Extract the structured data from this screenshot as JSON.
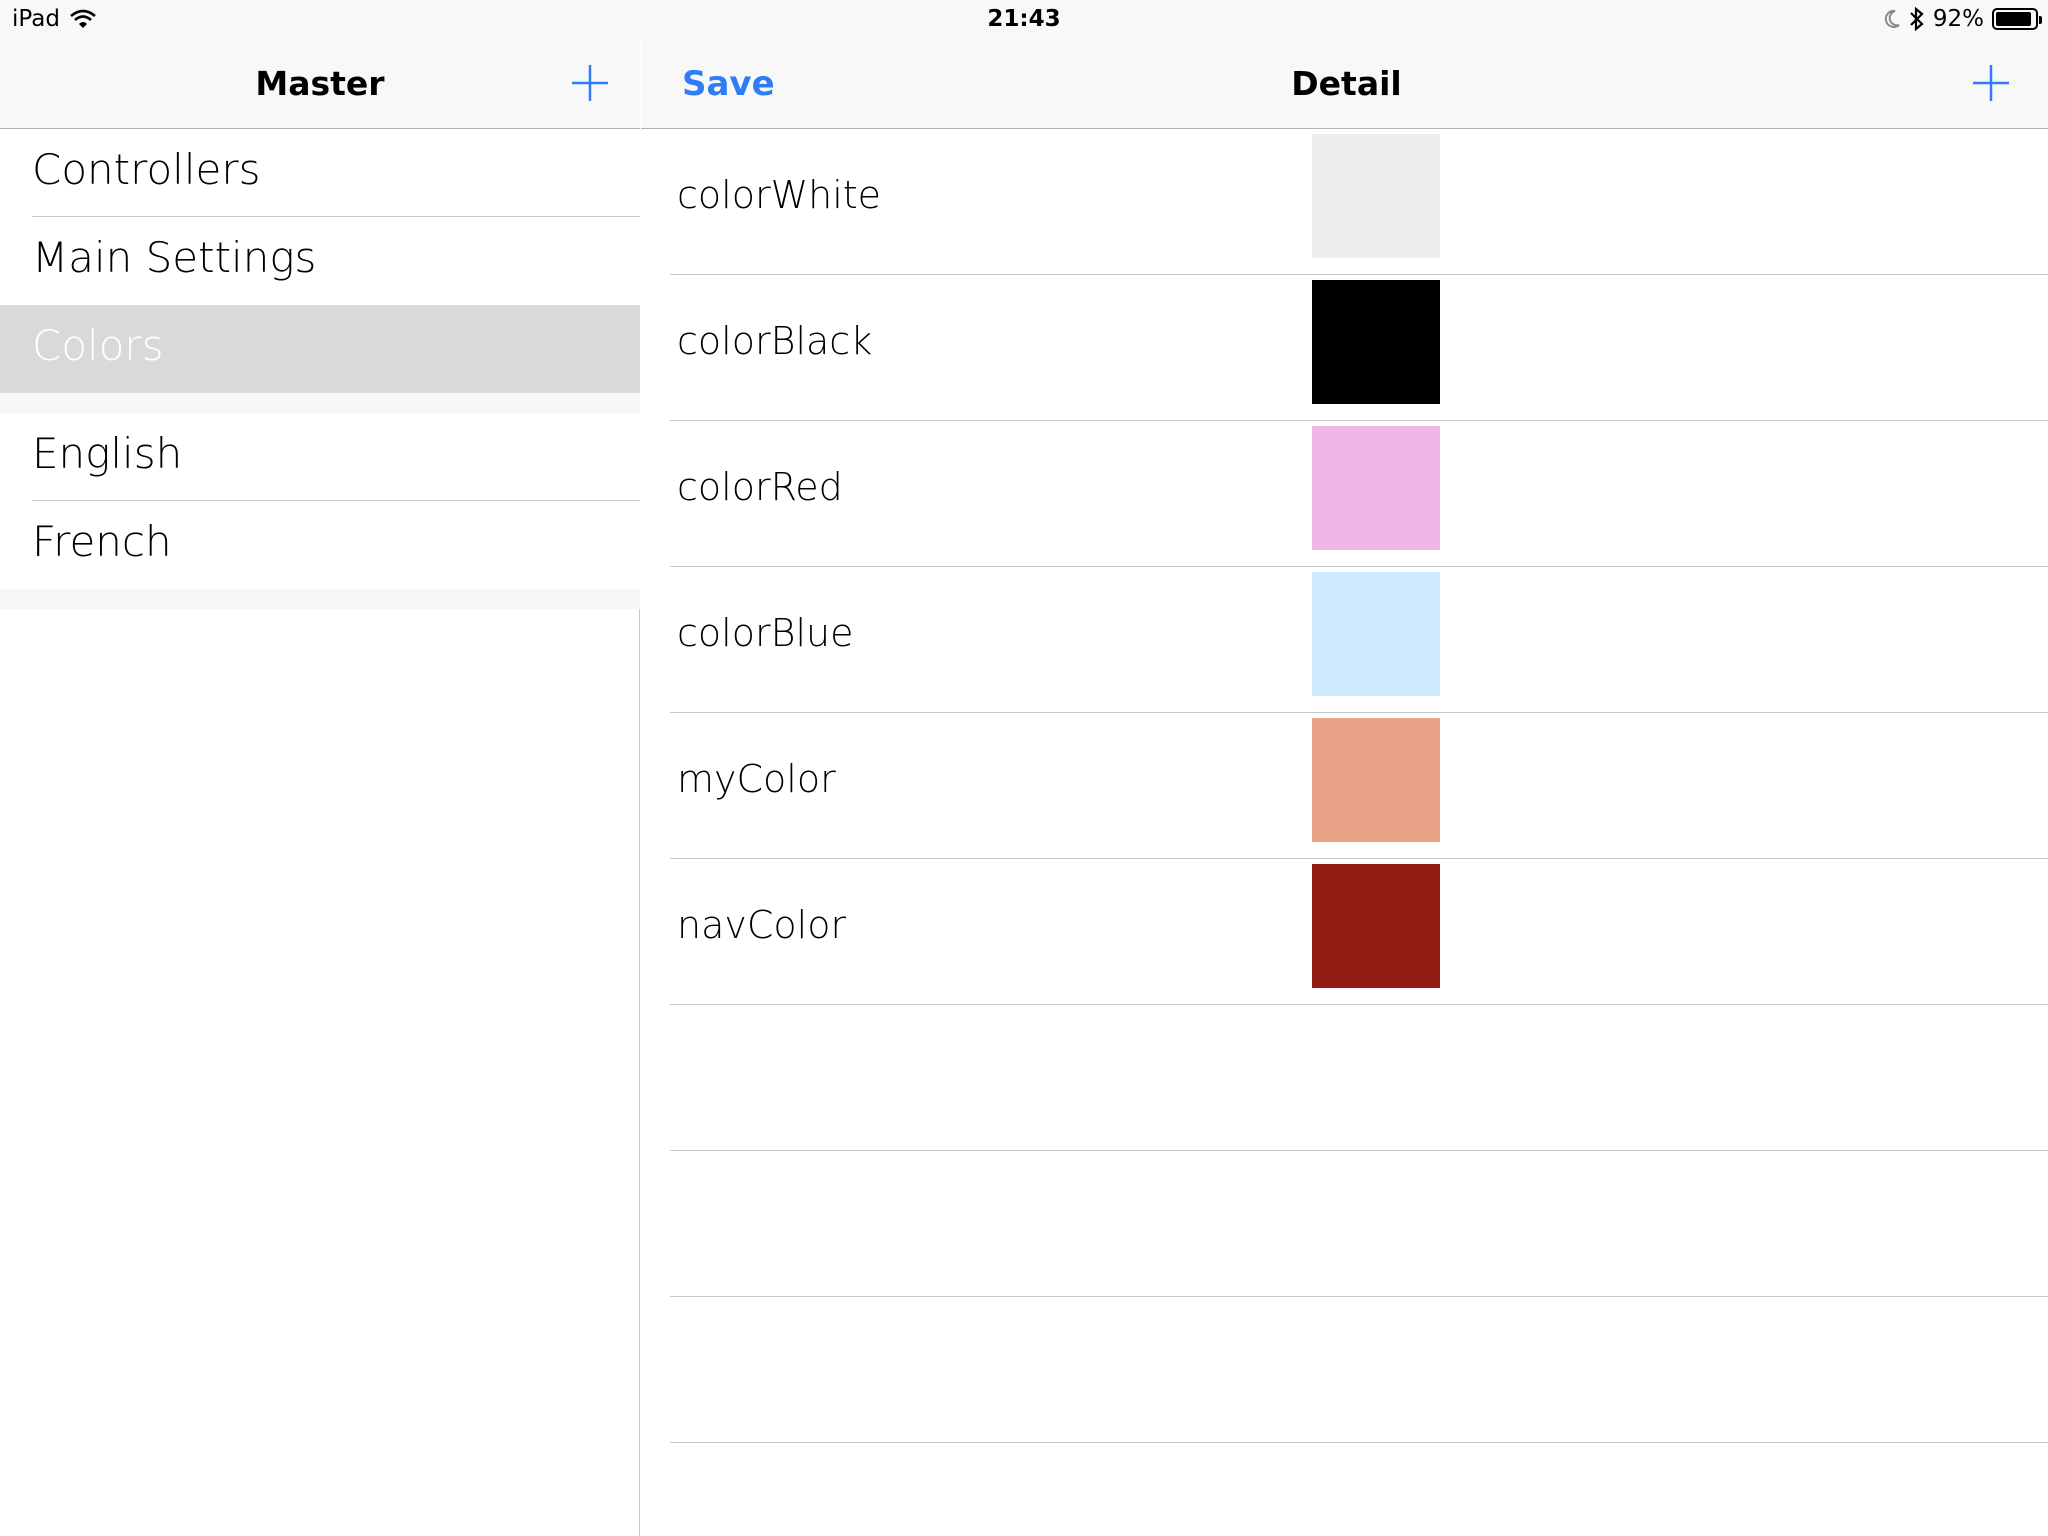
{
  "status_bar": {
    "device": "iPad",
    "time": "21:43",
    "battery": "92%",
    "battery_level": 0.92,
    "icons": [
      "wifi-icon",
      "moon-icon",
      "bluetooth-icon",
      "battery-icon"
    ]
  },
  "master": {
    "title": "Master",
    "add_icon": "plus-icon",
    "sections": [
      {
        "items": [
          {
            "label": "Controllers",
            "selected": false
          },
          {
            "label": "Main Settings",
            "selected": false
          },
          {
            "label": "Colors",
            "selected": true
          }
        ]
      },
      {
        "items": [
          {
            "label": "English",
            "selected": false
          },
          {
            "label": "French",
            "selected": false
          }
        ]
      }
    ]
  },
  "detail": {
    "title": "Detail",
    "save_label": "Save",
    "add_icon": "plus-icon",
    "accent_color": "#2e7cf6",
    "colors": [
      {
        "name": "colorWhite",
        "swatch": "#ebeced"
      },
      {
        "name": "colorBlack",
        "swatch": "#000000"
      },
      {
        "name": "colorRed",
        "swatch": "#f2b6e6"
      },
      {
        "name": "colorBlue",
        "swatch": "#cde9fb"
      },
      {
        "name": "myColor",
        "swatch": "#e9a386"
      },
      {
        "name": "navColor",
        "swatch": "#911a13"
      }
    ],
    "empty_rows": 3
  }
}
